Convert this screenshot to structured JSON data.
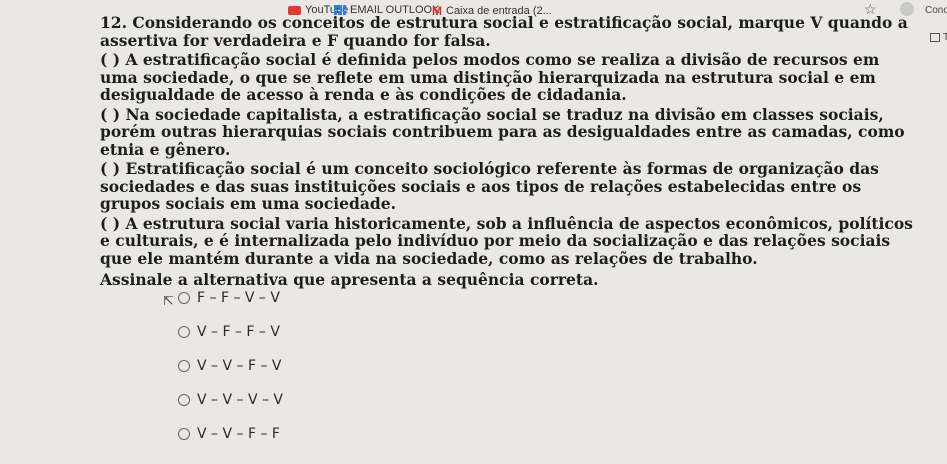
{
  "bookmarks": [
    {
      "label": "YouTube",
      "icon": "youtube-icon"
    },
    {
      "label": "EMAIL OUTLOOK",
      "icon": "grid-icon"
    },
    {
      "label": "Caixa de entrada (2...",
      "icon": "gmail-icon"
    }
  ],
  "toolbar": {
    "right_label": "Conclu",
    "side_label": "To"
  },
  "question": {
    "title": "12. Considerando os conceitos de estrutura social e estratificação social, marque V quando a assertiva for verdadeira e F quando for falsa.",
    "statements": [
      "( ) A estratificação social é definida pelos modos como se realiza a divisão de recursos em uma sociedade, o que se reflete em uma distinção hierarquizada na estrutura social e em desigualdade de acesso à renda e às condições de cidadania.",
      "( ) Na sociedade capitalista, a estratificação social se traduz na divisão em classes sociais, porém outras hierarquias sociais contribuem para as desigualdades entre as camadas, como etnia e gênero.",
      "( ) Estratificação social é um conceito sociológico referente às formas de organização das sociedades e das suas instituições sociais e aos tipos de relações estabelecidas entre os grupos sociais em uma sociedade.",
      "( ) A estrutura social varia historicamente, sob a influência de aspectos econômicos, políticos e culturais, e é internalizada pelo indivíduo por meio da socialização e das relações sociais que ele mantém durante a vida na sociedade, como as relações de trabalho."
    ],
    "prompt": "Assinale a alternativa que apresenta a sequência correta."
  },
  "alternatives": [
    "F – F – V – V",
    "V – F – F – V",
    "V – V – F – V",
    "V – V – V – V",
    "V – V – F – F"
  ]
}
